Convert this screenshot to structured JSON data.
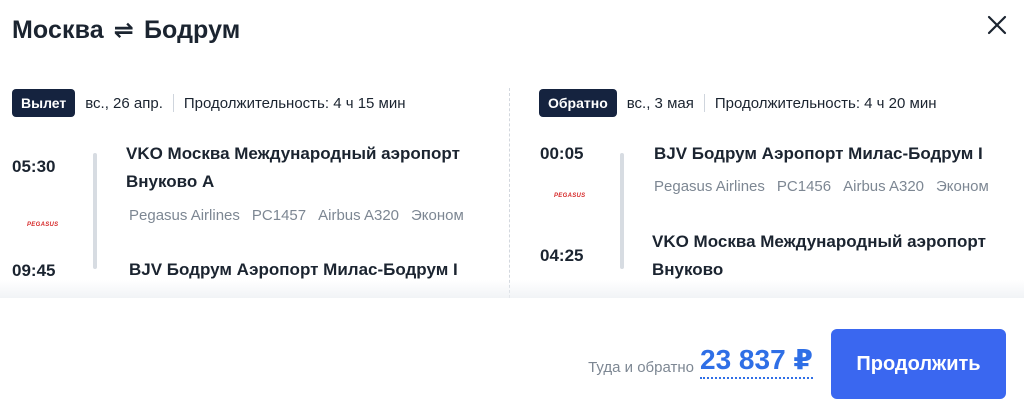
{
  "header": {
    "from_city": "Москва",
    "to_city": "Бодрум",
    "swap_icon": "arrows-exchange-icon",
    "close_icon": "close-icon"
  },
  "outbound": {
    "badge": "Вылет",
    "date": "вс., 26 апр.",
    "duration": "Продолжительность: 4 ч 15 мин",
    "depart_time": "05:30",
    "depart_airport": "VKO Москва Международный аэропорт Внуково A",
    "arrive_time": "09:45",
    "arrive_airport": "BJV Бодрум Аэропорт Милас-Бодрум I",
    "airline": "Pegasus Airlines",
    "flight": "PC1457",
    "aircraft": "Airbus A320",
    "class": "Эконом",
    "logo_text": "PEGASUS"
  },
  "return": {
    "badge": "Обратно",
    "date": "вс., 3 мая",
    "duration": "Продолжительность: 4 ч 20 мин",
    "depart_time": "00:05",
    "depart_airport": "BJV Бодрум Аэропорт Милас-Бодрум I",
    "arrive_time": "04:25",
    "arrive_airport": "VKO Москва Международный аэропорт Внуково",
    "airline": "Pegasus Airlines",
    "flight": "PC1456",
    "aircraft": "Airbus A320",
    "class": "Эконом",
    "logo_text": "PEGASUS"
  },
  "footer": {
    "total_label": "Туда и обратно",
    "price": "23 837 ₽",
    "continue_label": "Продолжить"
  },
  "colors": {
    "accent": "#3a67f0",
    "price": "#2f6fe6",
    "badge": "#15233f",
    "airline_logo": "#d62b2b"
  }
}
